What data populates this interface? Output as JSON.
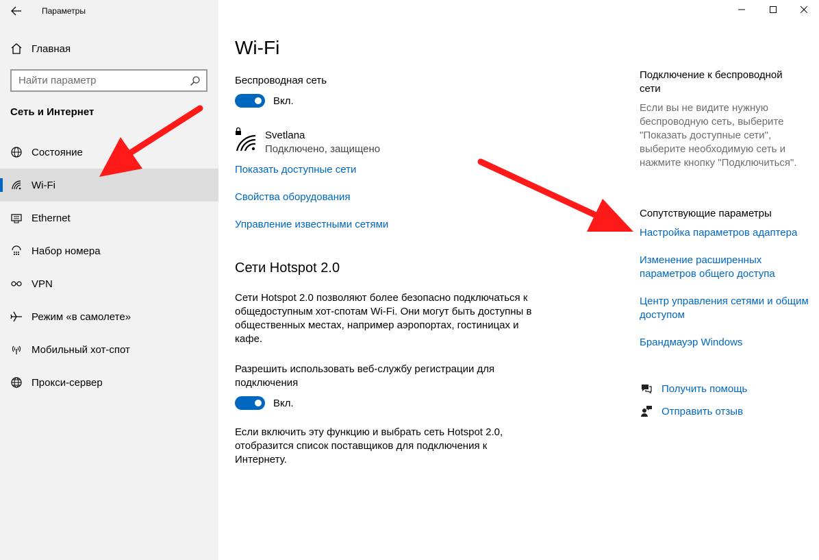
{
  "window": {
    "app_title": "Параметры",
    "colors": {
      "accent": "#0067c0",
      "sidebar_bg": "#f2f2f2",
      "active_bg": "#dcdcdc",
      "annotation": "#ff0000"
    }
  },
  "sidebar": {
    "home_label": "Главная",
    "search_placeholder": "Найти параметр",
    "section_title": "Сеть и Интернет",
    "items": [
      {
        "label": "Состояние",
        "icon": "globe-status-icon",
        "active": false
      },
      {
        "label": "Wi-Fi",
        "icon": "wifi-icon",
        "active": true
      },
      {
        "label": "Ethernet",
        "icon": "ethernet-icon",
        "active": false
      },
      {
        "label": "Набор номера",
        "icon": "dialup-icon",
        "active": false
      },
      {
        "label": "VPN",
        "icon": "vpn-icon",
        "active": false
      },
      {
        "label": "Режим «в самолете»",
        "icon": "airplane-icon",
        "active": false
      },
      {
        "label": "Мобильный хот-спот",
        "icon": "hotspot-icon",
        "active": false
      },
      {
        "label": "Прокси-сервер",
        "icon": "proxy-globe-icon",
        "active": false
      }
    ]
  },
  "main": {
    "title": "Wi-Fi",
    "wireless": {
      "label": "Беспроводная сеть",
      "toggle_label": "Вкл."
    },
    "network": {
      "name": "Svetlana",
      "status": "Подключено, защищено"
    },
    "links": [
      "Показать доступные сети",
      "Свойства оборудования",
      "Управление известными сетями"
    ],
    "hotspot": {
      "title": "Сети Hotspot 2.0",
      "description": "Сети Hotspot 2.0 позволяют более безопасно подключаться к общедоступным хот-спотам Wi-Fi. Они могут быть доступны в общественных местах, например аэропортах, гостиницах и кафе.",
      "allow_label": "Разрешить использовать веб-службу регистрации для подключения",
      "toggle_label": "Вкл.",
      "note": "Если включить эту функцию и выбрать сеть Hotspot 2.0, отобразится список поставщиков для подключения к Интернету."
    }
  },
  "right": {
    "connect_heading": "Подключение к беспроводной сети",
    "connect_desc": "Если вы не видите нужную беспроводную сеть, выберите \"Показать доступные сети\", выберите необходимую сеть и нажмите кнопку \"Подключиться\".",
    "related_heading": "Сопутствующие параметры",
    "related_links": [
      "Настройка параметров адаптера",
      "Изменение расширенных параметров общего доступа",
      "Центр управления сетями и общим доступом",
      "Брандмауэр Windows"
    ],
    "help": "Получить помощь",
    "feedback": "Отправить отзыв"
  }
}
